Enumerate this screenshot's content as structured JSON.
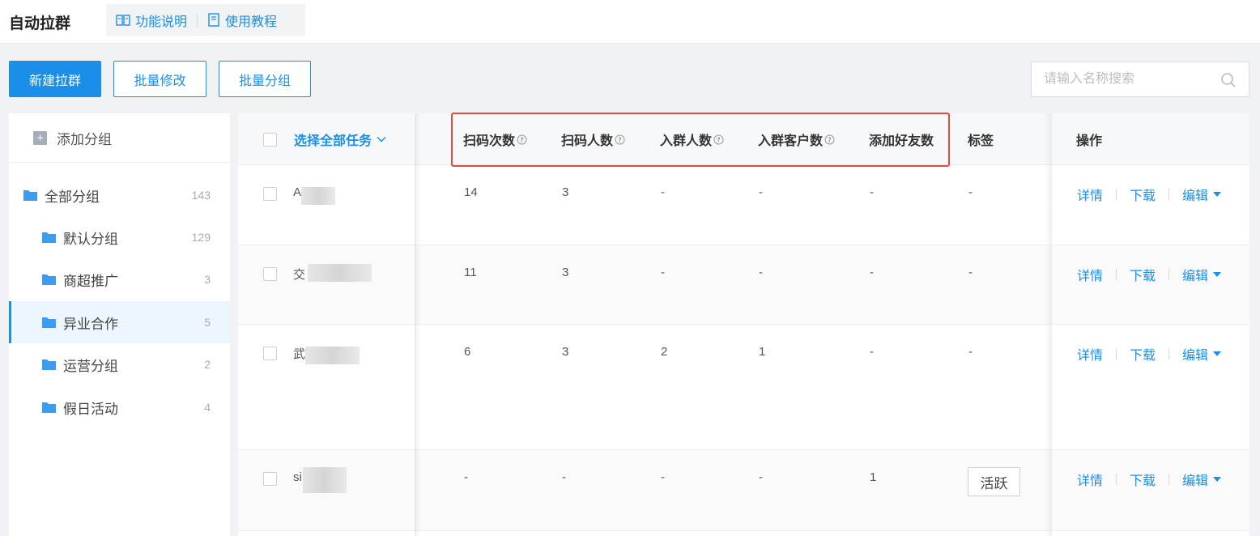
{
  "header": {
    "title": "自动拉群",
    "links": [
      {
        "label": "功能说明",
        "icon": "book-icon"
      },
      {
        "label": "使用教程",
        "icon": "document-icon"
      }
    ]
  },
  "toolbar": {
    "new_label": "新建拉群",
    "batch_edit_label": "批量修改",
    "batch_group_label": "批量分组",
    "search_placeholder": "请输入名称搜索"
  },
  "sidebar": {
    "add_group_label": "添加分组",
    "groups": [
      {
        "label": "全部分组",
        "count": "143",
        "level": 0
      },
      {
        "label": "默认分组",
        "count": "129",
        "level": 1
      },
      {
        "label": "商超推广",
        "count": "3",
        "level": 1
      },
      {
        "label": "异业合作",
        "count": "5",
        "level": 1,
        "active": true
      },
      {
        "label": "运营分组",
        "count": "2",
        "level": 1
      },
      {
        "label": "假日活动",
        "count": "4",
        "level": 1
      }
    ]
  },
  "table": {
    "select_all_label": "选择全部任务",
    "columns": {
      "scan_count": "扫码次数",
      "scan_people": "扫码人数",
      "join_people": "入群人数",
      "join_customers": "入群客户数",
      "add_friends": "添加好友数",
      "tags": "标签",
      "actions": "操作"
    },
    "action_labels": {
      "detail": "详情",
      "download": "下载",
      "edit": "编辑"
    },
    "rows": [
      {
        "name": "A",
        "scan_count": "14",
        "scan_people": "3",
        "join_people": "-",
        "join_customers": "-",
        "add_friends": "-",
        "tag": "-"
      },
      {
        "name": "交",
        "scan_count": "11",
        "scan_people": "3",
        "join_people": "-",
        "join_customers": "-",
        "add_friends": "-",
        "tag": "-"
      },
      {
        "name": "武",
        "scan_count": "6",
        "scan_people": "3",
        "join_people": "2",
        "join_customers": "1",
        "add_friends": "-",
        "tag": "-"
      },
      {
        "name": "si",
        "scan_count": "-",
        "scan_people": "-",
        "join_people": "-",
        "join_customers": "-",
        "add_friends": "1",
        "tag": "活跃"
      }
    ]
  },
  "colors": {
    "accent": "#1a8ee8",
    "highlight": "#e24b3b"
  }
}
